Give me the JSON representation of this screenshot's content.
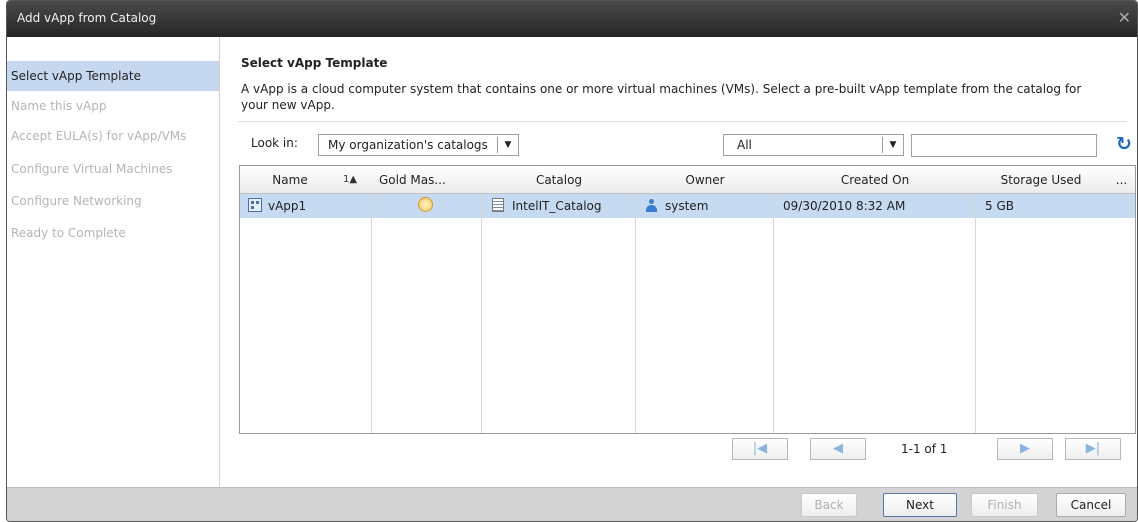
{
  "window": {
    "title": "Add vApp from Catalog",
    "close_glyph": "✕"
  },
  "sidebar": {
    "steps": [
      {
        "label": "Select vApp Template",
        "active": true
      },
      {
        "label": "Name this vApp"
      },
      {
        "label": "Accept EULA(s) for vApp/VMs"
      },
      {
        "label": "Configure Virtual Machines"
      },
      {
        "label": "Configure Networking"
      },
      {
        "label": "Ready to Complete"
      }
    ]
  },
  "main": {
    "heading": "Select vApp Template",
    "description": "A vApp is a cloud computer system that contains one or more virtual machines (VMs). Select a pre-built vApp template from the catalog for your new vApp."
  },
  "filters": {
    "look_in_label": "Look in:",
    "look_in_value": "My organization's catalogs",
    "type_value": "All",
    "search_value": ""
  },
  "table": {
    "columns": [
      "Name",
      "Gold Mas...",
      "Catalog",
      "Owner",
      "Created On",
      "Storage Used",
      "..."
    ],
    "sort_indicator": "1▲",
    "rows": [
      {
        "name": "vApp1",
        "catalog": "IntelIT_Catalog",
        "owner": "system",
        "created_on": "09/30/2010 8:32 AM",
        "storage_used": "5 GB"
      }
    ]
  },
  "pagination": {
    "label": "1-1 of 1"
  },
  "footer": {
    "back": "Back",
    "next": "Next",
    "finish": "Finish",
    "cancel": "Cancel"
  },
  "colors": {
    "selection": "#c6daf2",
    "active_step": "#c6d8ef",
    "accent": "#1f67c3"
  }
}
